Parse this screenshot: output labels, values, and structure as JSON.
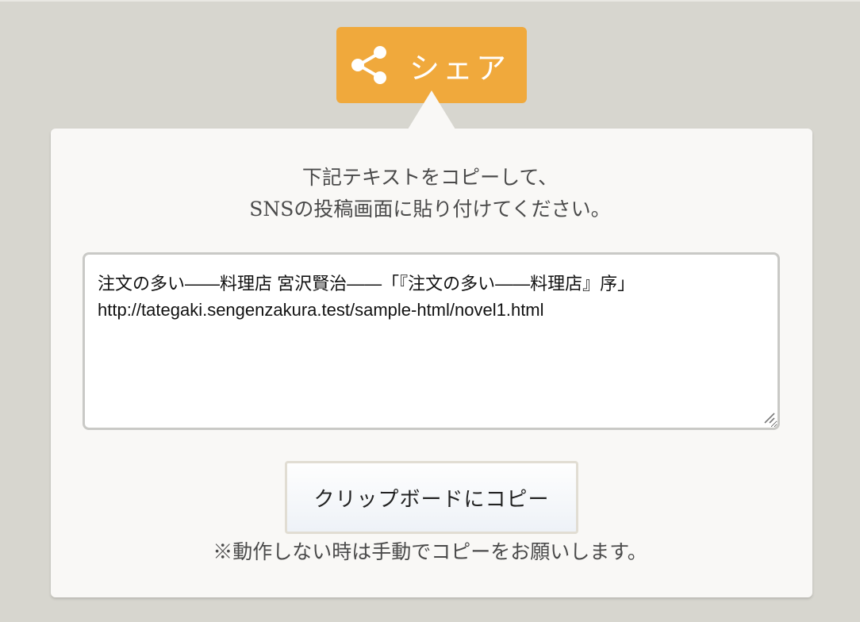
{
  "share": {
    "label": "シェア",
    "icon": "share-icon",
    "accent_color": "#f0a93c"
  },
  "panel": {
    "instruction_line1": "下記テキストをコピーして、",
    "instruction_line2": "SNSの投稿画面に貼り付けてください。",
    "textarea_line1": "注文の多い――料理店 宮沢賢治――「『注文の多い――料理店』序」",
    "textarea_line2": "http://tategaki.sengenzakura.test/sample-html/novel1.html",
    "copy_button_label": "クリップボードにコピー",
    "note": "※動作しない時は手動でコピーをお願いします。"
  }
}
